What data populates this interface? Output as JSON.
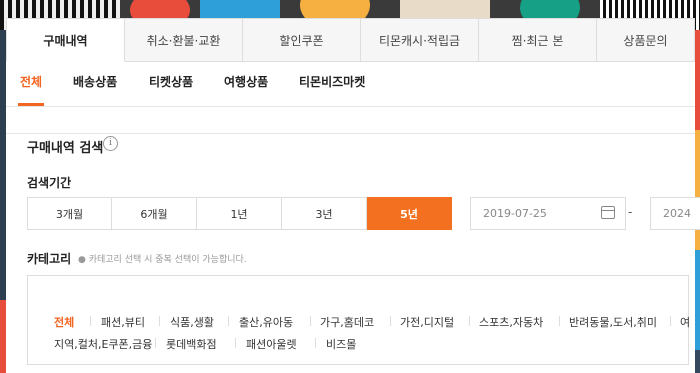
{
  "colors": {
    "accent": "#f37021",
    "border": "#dddddd"
  },
  "tabs": [
    "구매내역",
    "취소·환불·교환",
    "할인쿠폰",
    "티몬캐시·적립금",
    "찜·최근 본",
    "상품문의"
  ],
  "active_tab": 0,
  "subtabs": [
    "전체",
    "배송상품",
    "티켓상품",
    "여행상품",
    "티몬비즈마켓"
  ],
  "active_subtab": 0,
  "search": {
    "title": "구매내역 검색",
    "info_icon": "i",
    "period_label": "검색기간",
    "periods": [
      "3개월",
      "6개월",
      "1년",
      "3년",
      "5년"
    ],
    "active_period": 4,
    "start_date": "2019-07-25",
    "end_date": "2024",
    "separator": "-",
    "calendar_icon": "calendar-icon"
  },
  "category": {
    "label": "카테고리",
    "hint": "● 카테고리 선택 시 중복 선택이 가능합니다.",
    "row1": [
      "전체",
      "패션,뷰티",
      "식품,생활",
      "출산,유아동",
      "가구,홈데코",
      "가전,디지털",
      "스포츠,자동차",
      "반려동물,도서,취미",
      "여"
    ],
    "row2": [
      "지역,컬처,E쿠폰,금융",
      "롯데백화점",
      "패션아울렛",
      "비즈몰"
    ]
  }
}
